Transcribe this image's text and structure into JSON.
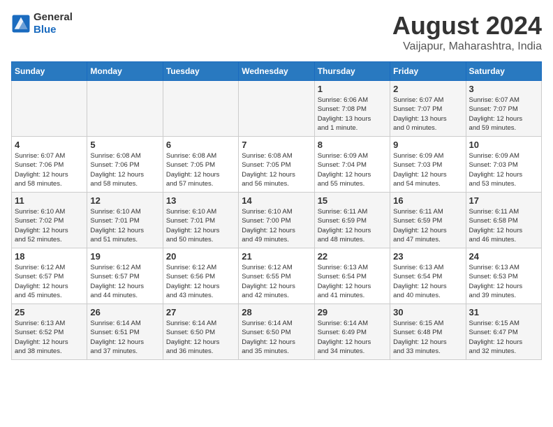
{
  "header": {
    "logo_general": "General",
    "logo_blue": "Blue",
    "title": "August 2024",
    "subtitle": "Vaijapur, Maharashtra, India"
  },
  "days_of_week": [
    "Sunday",
    "Monday",
    "Tuesday",
    "Wednesday",
    "Thursday",
    "Friday",
    "Saturday"
  ],
  "weeks": [
    [
      {
        "day": "",
        "info": ""
      },
      {
        "day": "",
        "info": ""
      },
      {
        "day": "",
        "info": ""
      },
      {
        "day": "",
        "info": ""
      },
      {
        "day": "1",
        "info": "Sunrise: 6:06 AM\nSunset: 7:08 PM\nDaylight: 13 hours\nand 1 minute."
      },
      {
        "day": "2",
        "info": "Sunrise: 6:07 AM\nSunset: 7:07 PM\nDaylight: 13 hours\nand 0 minutes."
      },
      {
        "day": "3",
        "info": "Sunrise: 6:07 AM\nSunset: 7:07 PM\nDaylight: 12 hours\nand 59 minutes."
      }
    ],
    [
      {
        "day": "4",
        "info": "Sunrise: 6:07 AM\nSunset: 7:06 PM\nDaylight: 12 hours\nand 58 minutes."
      },
      {
        "day": "5",
        "info": "Sunrise: 6:08 AM\nSunset: 7:06 PM\nDaylight: 12 hours\nand 58 minutes."
      },
      {
        "day": "6",
        "info": "Sunrise: 6:08 AM\nSunset: 7:05 PM\nDaylight: 12 hours\nand 57 minutes."
      },
      {
        "day": "7",
        "info": "Sunrise: 6:08 AM\nSunset: 7:05 PM\nDaylight: 12 hours\nand 56 minutes."
      },
      {
        "day": "8",
        "info": "Sunrise: 6:09 AM\nSunset: 7:04 PM\nDaylight: 12 hours\nand 55 minutes."
      },
      {
        "day": "9",
        "info": "Sunrise: 6:09 AM\nSunset: 7:03 PM\nDaylight: 12 hours\nand 54 minutes."
      },
      {
        "day": "10",
        "info": "Sunrise: 6:09 AM\nSunset: 7:03 PM\nDaylight: 12 hours\nand 53 minutes."
      }
    ],
    [
      {
        "day": "11",
        "info": "Sunrise: 6:10 AM\nSunset: 7:02 PM\nDaylight: 12 hours\nand 52 minutes."
      },
      {
        "day": "12",
        "info": "Sunrise: 6:10 AM\nSunset: 7:01 PM\nDaylight: 12 hours\nand 51 minutes."
      },
      {
        "day": "13",
        "info": "Sunrise: 6:10 AM\nSunset: 7:01 PM\nDaylight: 12 hours\nand 50 minutes."
      },
      {
        "day": "14",
        "info": "Sunrise: 6:10 AM\nSunset: 7:00 PM\nDaylight: 12 hours\nand 49 minutes."
      },
      {
        "day": "15",
        "info": "Sunrise: 6:11 AM\nSunset: 6:59 PM\nDaylight: 12 hours\nand 48 minutes."
      },
      {
        "day": "16",
        "info": "Sunrise: 6:11 AM\nSunset: 6:59 PM\nDaylight: 12 hours\nand 47 minutes."
      },
      {
        "day": "17",
        "info": "Sunrise: 6:11 AM\nSunset: 6:58 PM\nDaylight: 12 hours\nand 46 minutes."
      }
    ],
    [
      {
        "day": "18",
        "info": "Sunrise: 6:12 AM\nSunset: 6:57 PM\nDaylight: 12 hours\nand 45 minutes."
      },
      {
        "day": "19",
        "info": "Sunrise: 6:12 AM\nSunset: 6:57 PM\nDaylight: 12 hours\nand 44 minutes."
      },
      {
        "day": "20",
        "info": "Sunrise: 6:12 AM\nSunset: 6:56 PM\nDaylight: 12 hours\nand 43 minutes."
      },
      {
        "day": "21",
        "info": "Sunrise: 6:12 AM\nSunset: 6:55 PM\nDaylight: 12 hours\nand 42 minutes."
      },
      {
        "day": "22",
        "info": "Sunrise: 6:13 AM\nSunset: 6:54 PM\nDaylight: 12 hours\nand 41 minutes."
      },
      {
        "day": "23",
        "info": "Sunrise: 6:13 AM\nSunset: 6:54 PM\nDaylight: 12 hours\nand 40 minutes."
      },
      {
        "day": "24",
        "info": "Sunrise: 6:13 AM\nSunset: 6:53 PM\nDaylight: 12 hours\nand 39 minutes."
      }
    ],
    [
      {
        "day": "25",
        "info": "Sunrise: 6:13 AM\nSunset: 6:52 PM\nDaylight: 12 hours\nand 38 minutes."
      },
      {
        "day": "26",
        "info": "Sunrise: 6:14 AM\nSunset: 6:51 PM\nDaylight: 12 hours\nand 37 minutes."
      },
      {
        "day": "27",
        "info": "Sunrise: 6:14 AM\nSunset: 6:50 PM\nDaylight: 12 hours\nand 36 minutes."
      },
      {
        "day": "28",
        "info": "Sunrise: 6:14 AM\nSunset: 6:50 PM\nDaylight: 12 hours\nand 35 minutes."
      },
      {
        "day": "29",
        "info": "Sunrise: 6:14 AM\nSunset: 6:49 PM\nDaylight: 12 hours\nand 34 minutes."
      },
      {
        "day": "30",
        "info": "Sunrise: 6:15 AM\nSunset: 6:48 PM\nDaylight: 12 hours\nand 33 minutes."
      },
      {
        "day": "31",
        "info": "Sunrise: 6:15 AM\nSunset: 6:47 PM\nDaylight: 12 hours\nand 32 minutes."
      }
    ]
  ]
}
